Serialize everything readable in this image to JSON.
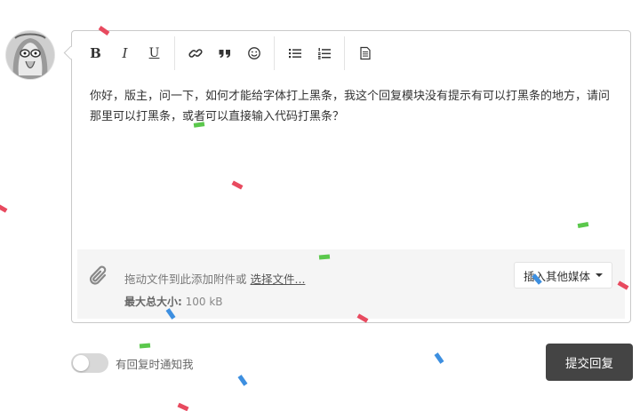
{
  "colors": {
    "confetti_red": "#e84a5f",
    "confetti_green": "#5bc84c",
    "confetti_blue": "#3d8fe0",
    "submit_bg": "#444444"
  },
  "avatar": {
    "icon": "user-avatar-icon"
  },
  "toolbar": {
    "bold_label": "B",
    "italic_label": "I",
    "underline_label": "U",
    "icons": [
      "link-icon",
      "quote-icon",
      "emoji-icon",
      "bullet-list-icon",
      "numbered-list-icon",
      "source-document-icon"
    ]
  },
  "editor": {
    "content": "你好，版主，问一下，如何才能给字体打上黑条，我这个回复模块没有提示有可以打黑条的地方，请问那里可以打黑条，或者可以直接输入代码打黑条？"
  },
  "attachments": {
    "drop_text": "拖动文件到此添加附件或",
    "choose_link": "选择文件...",
    "max_size_label": "最大总大小:",
    "max_size_value": "100 kB",
    "insert_media_label": "插入其他媒体"
  },
  "notify": {
    "label": "有回复时通知我",
    "enabled": false
  },
  "submit": {
    "label": "提交回复"
  }
}
